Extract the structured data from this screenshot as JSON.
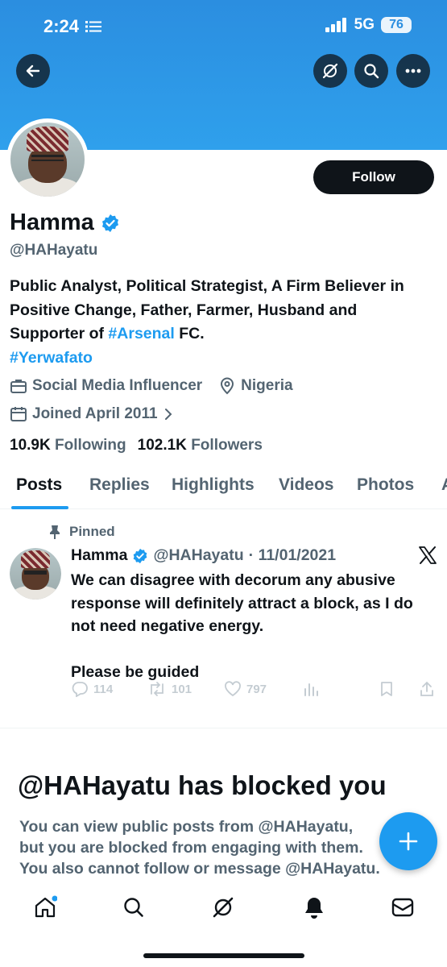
{
  "status_bar": {
    "time": "2:24",
    "network": "5G",
    "battery": "76"
  },
  "profile": {
    "name": "Hamma",
    "handle": "@HAHayatu",
    "follow_label": "Follow",
    "bio_text_1": "Public Analyst, Political Strategist, A Firm Believer in Positive Change, Father, Farmer, Husband and Supporter of ",
    "bio_tag_1": "#Arsenal",
    "bio_text_2": " FC.",
    "bio_tag_2": "#Yerwafato",
    "category": "Social Media Influencer",
    "location": "Nigeria",
    "joined": "Joined April 2011",
    "following_count": "10.9K",
    "following_label": "Following",
    "followers_count": "102.1K",
    "followers_label": "Followers"
  },
  "tabs": [
    {
      "label": "Posts"
    },
    {
      "label": "Replies"
    },
    {
      "label": "Highlights"
    },
    {
      "label": "Videos"
    },
    {
      "label": "Photos"
    },
    {
      "label": "A"
    }
  ],
  "pinned_post": {
    "pinned_label": "Pinned",
    "author": "Hamma",
    "handle": "@HAHayatu",
    "date": "· 11/01/2021",
    "text_1": "We can disagree with decorum any abusive response will definitely attract a block, as I do not need negative energy.",
    "text_2": "Please be guided",
    "replies": "114",
    "reposts": "101",
    "likes": "797"
  },
  "blocked": {
    "title": "@HAHayatu has blocked you",
    "line_1": "You can view public posts from @HAHayatu,",
    "line_2": "but you are blocked from engaging with them.",
    "line_3": "You also cannot follow or message @HAHayatu."
  },
  "colors": {
    "accent": "#1d9bf0",
    "banner": "#2b8ee0",
    "text": "#0f1419",
    "muted": "#536471"
  }
}
